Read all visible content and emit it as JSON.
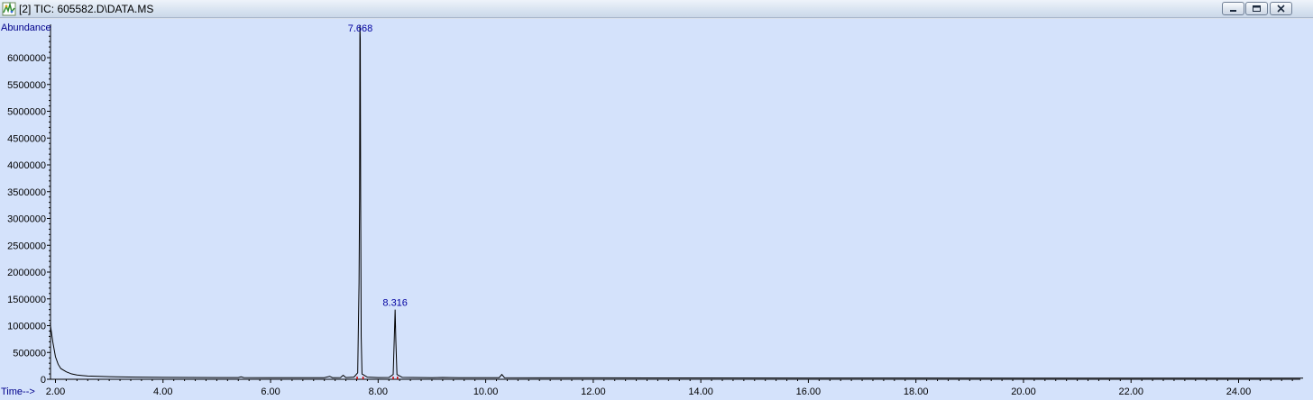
{
  "window": {
    "title": "[2] TIC: 605582.D\\DATA.MS",
    "colors": {
      "titlebar": "#d9e4f1",
      "plot_background": "#d4e2fb",
      "trace": "#000000",
      "axis_label": "#00008b",
      "peak_label": "#0000a0",
      "baseline_marker": "#cc0000"
    }
  },
  "controls": {
    "minimize_icon": "minimize-icon",
    "restore_icon": "restore-icon",
    "close_icon": "close-icon"
  },
  "chart_data": {
    "type": "line",
    "ylabel": "Abundance",
    "xlabel": "Time-->",
    "xlim": [
      1.9,
      25.2
    ],
    "ylim": [
      0,
      6700000
    ],
    "x_ticks": [
      2,
      4,
      6,
      8,
      10,
      12,
      14,
      16,
      18,
      20,
      22,
      24
    ],
    "x_tick_labels": [
      "2.00",
      "4.00",
      "6.00",
      "8.00",
      "10.00",
      "12.00",
      "14.00",
      "16.00",
      "18.00",
      "20.00",
      "22.00",
      "24.00"
    ],
    "y_ticks": [
      0,
      500000,
      1000000,
      1500000,
      2000000,
      2500000,
      3000000,
      3500000,
      4000000,
      4500000,
      5000000,
      5500000,
      6000000
    ],
    "y_tick_labels": [
      "0",
      "500000",
      "1000000",
      "1500000",
      "2000000",
      "2500000",
      "3000000",
      "3500000",
      "4000000",
      "4500000",
      "5000000",
      "5500000",
      "6000000"
    ],
    "grid": false,
    "series": [
      {
        "points": [
          [
            1.9,
            1050000
          ],
          [
            1.95,
            700000
          ],
          [
            2.0,
            420000
          ],
          [
            2.05,
            280000
          ],
          [
            2.1,
            200000
          ],
          [
            2.2,
            140000
          ],
          [
            2.3,
            100000
          ],
          [
            2.4,
            80000
          ],
          [
            2.5,
            70000
          ],
          [
            2.6,
            60000
          ],
          [
            2.8,
            55000
          ],
          [
            3.0,
            48000
          ],
          [
            3.5,
            40000
          ],
          [
            4.0,
            36000
          ],
          [
            4.5,
            33000
          ],
          [
            5.0,
            31000
          ],
          [
            5.4,
            32000
          ],
          [
            5.45,
            45000
          ],
          [
            5.5,
            32000
          ],
          [
            6.0,
            30000
          ],
          [
            6.5,
            29000
          ],
          [
            7.0,
            30000
          ],
          [
            7.1,
            55000
          ],
          [
            7.15,
            30000
          ],
          [
            7.3,
            32000
          ],
          [
            7.35,
            75000
          ],
          [
            7.4,
            32000
          ],
          [
            7.55,
            40000
          ],
          [
            7.62,
            120000
          ],
          [
            7.645,
            1800000
          ],
          [
            7.655,
            3400000
          ],
          [
            7.661,
            6600000
          ],
          [
            7.668,
            6350000
          ],
          [
            7.675,
            3350000
          ],
          [
            7.685,
            800000
          ],
          [
            7.7,
            100000
          ],
          [
            7.8,
            40000
          ],
          [
            8.0,
            32000
          ],
          [
            8.2,
            33000
          ],
          [
            8.28,
            90000
          ],
          [
            8.3,
            750000
          ],
          [
            8.316,
            1300000
          ],
          [
            8.33,
            700000
          ],
          [
            8.35,
            90000
          ],
          [
            8.45,
            35000
          ],
          [
            9.0,
            30000
          ],
          [
            9.2,
            34000
          ],
          [
            9.5,
            30000
          ],
          [
            10.0,
            29000
          ],
          [
            10.25,
            30000
          ],
          [
            10.3,
            90000
          ],
          [
            10.35,
            30000
          ],
          [
            11.0,
            28000
          ],
          [
            12.0,
            27000
          ],
          [
            13.0,
            26000
          ],
          [
            14.0,
            25000
          ],
          [
            16.0,
            24000
          ],
          [
            18.0,
            23000
          ],
          [
            20.0,
            22000
          ],
          [
            22.0,
            22000
          ],
          [
            24.0,
            21000
          ],
          [
            25.2,
            21000
          ]
        ]
      }
    ],
    "annotations": [
      {
        "x": 7.668,
        "label": "7.668"
      },
      {
        "x": 8.316,
        "label": "8.316"
      }
    ],
    "baseline_markers": [
      7.61,
      7.72,
      8.28,
      8.36
    ]
  }
}
